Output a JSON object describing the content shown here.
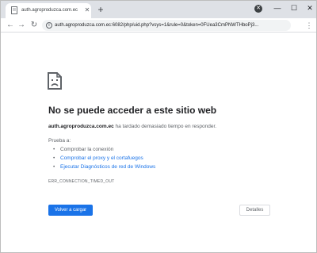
{
  "tab": {
    "title": "auth.agroproduzca.com.ec",
    "close_glyph": "✕",
    "favicon": "page-icon"
  },
  "newtab_glyph": "+",
  "profile_glyph": "✕",
  "window": {
    "minimize_glyph": "—",
    "maximize_glyph": "☐",
    "close_glyph": "✕"
  },
  "toolbar": {
    "back_glyph": "←",
    "forward_glyph": "→",
    "reload_glyph": "↻",
    "info_glyph": "i",
    "url": "auth.agroproduzca.com.ec:6082/php/uid.php?vsys=1&rule=0&token=0FUea3CmPNWTHboPj3...",
    "menu_glyph": "⋮"
  },
  "error": {
    "icon": "sad-page-icon",
    "heading": "No se puede acceder a este sitio web",
    "host": "auth.agroproduzca.com.ec",
    "description_rest": " ha tardado demasiado tiempo en responder.",
    "try_label": "Prueba a:",
    "suggestions": [
      {
        "text": "Comprobar la conexión",
        "is_link": false
      },
      {
        "text": "Comprobar el proxy y el cortafuegos",
        "is_link": true
      },
      {
        "text": "Ejecutar Diagnósticos de red de Windows",
        "is_link": true
      }
    ],
    "code": "ERR_CONNECTION_TIMED_OUT",
    "reload_button": "Volver a cargar",
    "details_button": "Detalles"
  },
  "colors": {
    "accent": "#1a73e8",
    "tabstrip": "#dee1e6",
    "text": "#202124",
    "secondary_text": "#5f6368"
  }
}
